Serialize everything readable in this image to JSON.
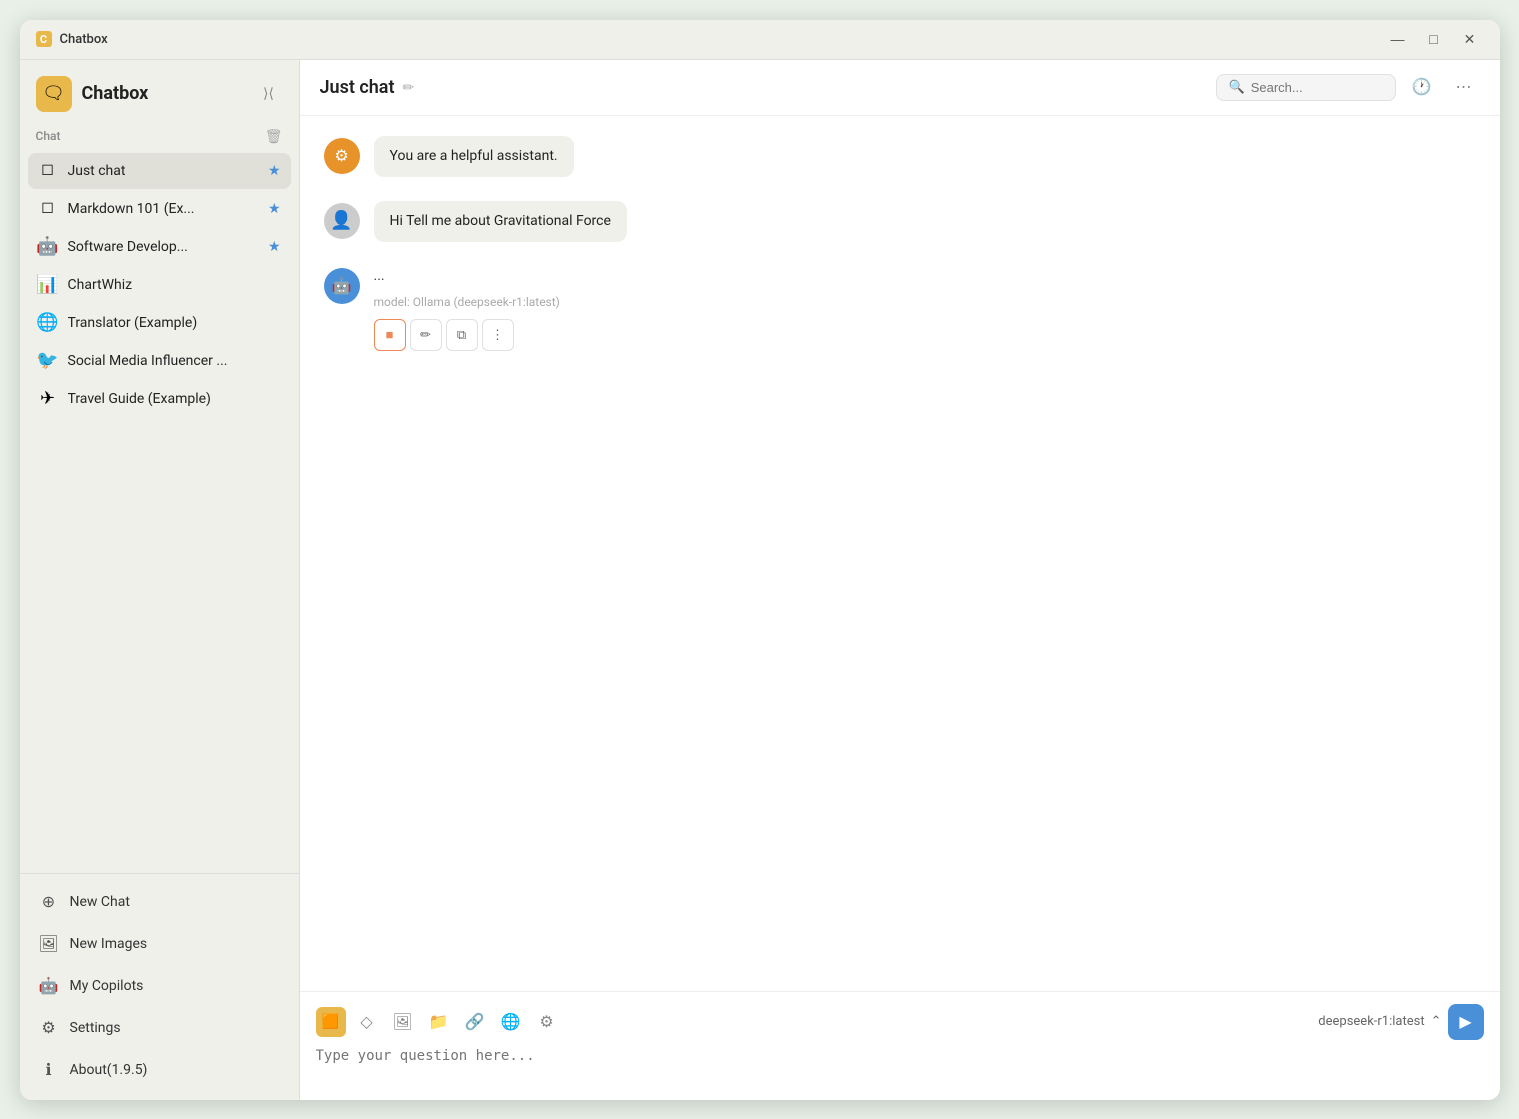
{
  "app": {
    "title": "Chatbox",
    "logo": "🗨",
    "version": "1.9.5"
  },
  "titlebar": {
    "title": "Chatbox",
    "minimize": "—",
    "maximize": "□",
    "close": "✕"
  },
  "sidebar": {
    "section_label": "Chat",
    "items": [
      {
        "id": "just-chat",
        "label": "Just chat",
        "icon": "☐",
        "starred": true,
        "active": true
      },
      {
        "id": "markdown-101",
        "label": "Markdown 101 (Ex...",
        "icon": "☐",
        "starred": true,
        "active": false
      },
      {
        "id": "software-develop",
        "label": "Software Develop...",
        "icon": "🤖",
        "starred": true,
        "active": false
      },
      {
        "id": "chartwhiz",
        "label": "ChartWhiz",
        "icon": "📊",
        "starred": false,
        "active": false
      },
      {
        "id": "translator",
        "label": "Translator (Example)",
        "icon": "🌐",
        "starred": false,
        "active": false
      },
      {
        "id": "social-media",
        "label": "Social Media Influencer ...",
        "icon": "🐦",
        "starred": false,
        "active": false
      },
      {
        "id": "travel-guide",
        "label": "Travel Guide (Example)",
        "icon": "✈",
        "starred": false,
        "active": false
      }
    ],
    "bottom_items": [
      {
        "id": "new-chat",
        "label": "New Chat",
        "icon": "⊕"
      },
      {
        "id": "new-images",
        "label": "New Images",
        "icon": "🖼"
      },
      {
        "id": "my-copilots",
        "label": "My Copilots",
        "icon": "🤖"
      },
      {
        "id": "settings",
        "label": "Settings",
        "icon": "⚙"
      },
      {
        "id": "about",
        "label": "About(1.9.5)",
        "icon": "ℹ"
      }
    ]
  },
  "chat": {
    "title": "Just chat",
    "search_placeholder": "Search...",
    "messages": [
      {
        "id": "system-msg",
        "role": "system",
        "avatar_type": "system",
        "avatar_char": "⚙",
        "content": "You are a helpful assistant."
      },
      {
        "id": "user-msg",
        "role": "user",
        "avatar_type": "user",
        "avatar_char": "👤",
        "content": "Hi Tell me about Gravitational Force"
      },
      {
        "id": "assistant-msg",
        "role": "assistant",
        "avatar_type": "assistant",
        "avatar_char": "🤖",
        "content": "...",
        "model": "model: Ollama (deepseek-r1:latest)"
      }
    ],
    "input_placeholder": "Type your question here...",
    "model_selector": "deepseek-r1:latest",
    "model_selector_arrow": "⌃"
  },
  "toolbar": {
    "stop_label": "■",
    "edit_label": "✏",
    "copy_label": "⧉",
    "more_label": "⋮",
    "input_icons": [
      "🟧",
      "◇",
      "🖼",
      "📁",
      "🔗",
      "🌐",
      "⚙"
    ]
  }
}
